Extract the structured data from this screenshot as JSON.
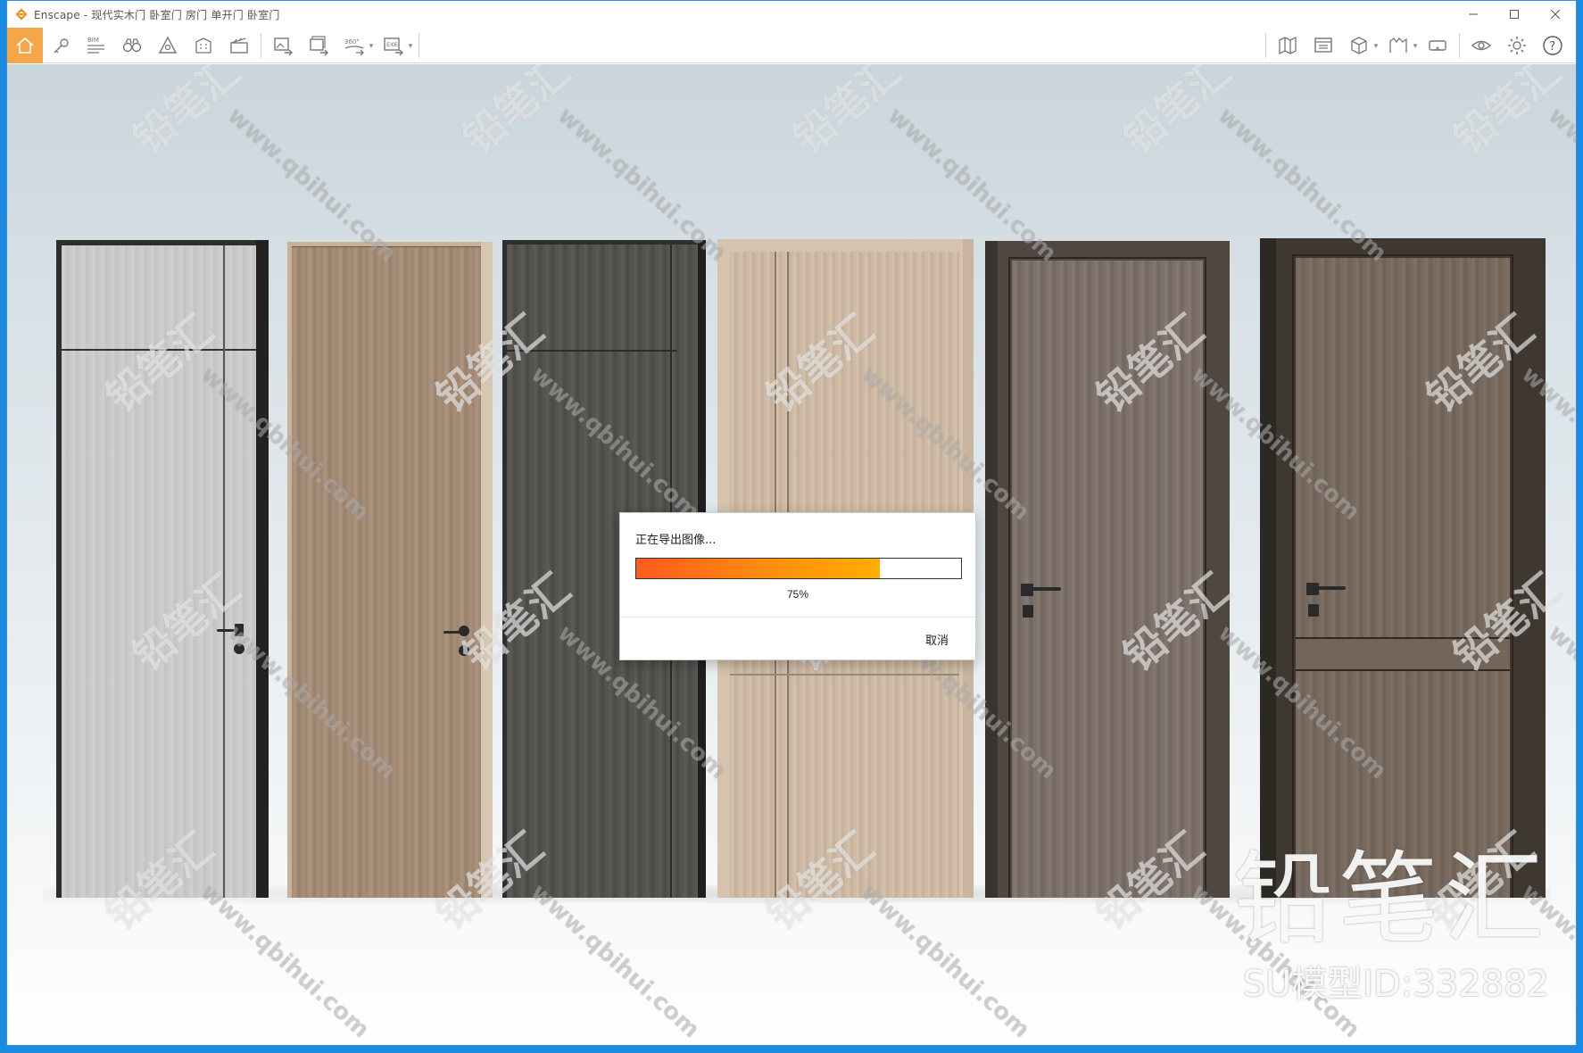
{
  "window": {
    "title": "Enscape - 现代实木门 卧室门 房门 单开门 卧室门",
    "controls": [
      "minimize",
      "maximize",
      "close"
    ]
  },
  "toolbar": {
    "left_tools": [
      {
        "name": "home",
        "icon": "home-icon",
        "active": true
      },
      {
        "name": "views",
        "icon": "key-icon"
      },
      {
        "name": "bim",
        "icon": "bim-icon",
        "label": "BIM"
      },
      {
        "name": "binoculars",
        "icon": "binoculars-icon"
      },
      {
        "name": "assets",
        "icon": "atmosphere-icon"
      },
      {
        "name": "building",
        "icon": "building-icon"
      },
      {
        "name": "video",
        "icon": "clapper-icon"
      }
    ],
    "export_tools": [
      {
        "name": "export-image",
        "icon": "export-image-icon"
      },
      {
        "name": "batch-export",
        "icon": "batch-export-icon"
      },
      {
        "name": "panorama",
        "icon": "panorama-icon",
        "label": "360°"
      },
      {
        "name": "exe-export",
        "icon": "exe-export-icon",
        "label": "EXE"
      }
    ],
    "right_tools": [
      {
        "name": "map",
        "icon": "map-icon"
      },
      {
        "name": "manager",
        "icon": "manager-icon"
      },
      {
        "name": "cube",
        "icon": "cube-icon"
      },
      {
        "name": "material",
        "icon": "material-icon"
      },
      {
        "name": "vr",
        "icon": "vr-icon"
      },
      {
        "name": "eye",
        "icon": "eye-icon"
      },
      {
        "name": "settings",
        "icon": "gear-icon"
      },
      {
        "name": "help",
        "icon": "help-icon"
      }
    ]
  },
  "viewport": {
    "background": "studio-gradient",
    "doors": [
      {
        "id": "door-1",
        "finish": "light-grey-oak",
        "color": "#c7c8c8",
        "frame_color": "#2e2e2e"
      },
      {
        "id": "door-2",
        "finish": "natural-walnut",
        "color": "#a58c76",
        "frame_color": "#c6b39a"
      },
      {
        "id": "door-3",
        "finish": "dark-grey-oak",
        "color": "#55534f",
        "frame_color": "#2f2f2f"
      },
      {
        "id": "door-4",
        "finish": "light-ash",
        "color": "#cdb9a4",
        "frame_color": "#d5c3ad"
      },
      {
        "id": "door-5",
        "finish": "grey-brown-oak",
        "color": "#7d7168",
        "frame_color": "#4f4740"
      },
      {
        "id": "door-6",
        "finish": "smoked-oak",
        "color": "#78695d",
        "frame_color": "#3e3831"
      }
    ]
  },
  "watermarks": {
    "repeat_text": "铅笔汇",
    "repeat_url": "www.qbihui.com",
    "brand_logo_text": "铅笔汇",
    "model_id": "SU模型ID:332882"
  },
  "export_dialog": {
    "title": "正在导出图像...",
    "progress_percent": 75,
    "progress_label": "75%",
    "cancel_label": "取消"
  },
  "colors": {
    "accent": "#f5a64a",
    "progress_start": "#ff5a1f",
    "progress_end": "#ffad00",
    "taskbar_blue": "#1a8be0"
  }
}
